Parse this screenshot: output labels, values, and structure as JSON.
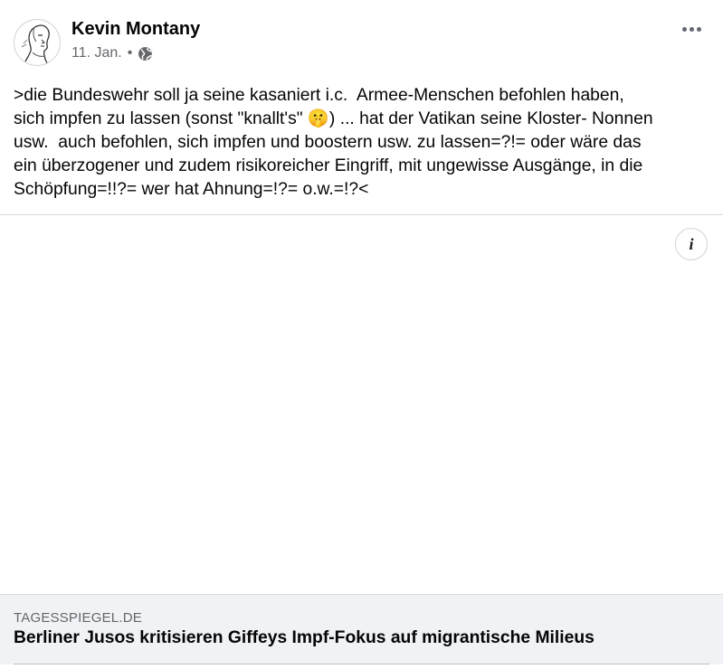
{
  "post": {
    "author": "Kevin Montany",
    "date": "11. Jan.",
    "separator": "•",
    "privacy_icon": "globe-icon",
    "body": ">die Bundeswehr soll ja seine kasaniert i.c.  Armee-Menschen befohlen haben,\nsich impfen zu lassen (sonst \"knallt's\" 🤫) ... hat der Vatikan seine Kloster- Nonnen\nusw.  auch befohlen, sich impfen und boostern usw. zu lassen=?!= oder wäre das\nein überzogener und zudem risikoreicher Eingriff, mit ungewisse Ausgänge, in die\nSchöpfung=!!?= wer hat Ahnung=!?= o.w.=!?<"
  },
  "link": {
    "domain": "TAGESSPIEGEL.DE",
    "title": "Berliner Jusos kritisieren Giffeys Impf-Fokus auf migrantische Milieus"
  },
  "icons": {
    "more": "more-options-icon",
    "info": "info-icon"
  },
  "colors": {
    "text": "#050505",
    "secondary": "#65676b",
    "card_bg": "#f0f2f5",
    "divider": "#dadde1"
  }
}
